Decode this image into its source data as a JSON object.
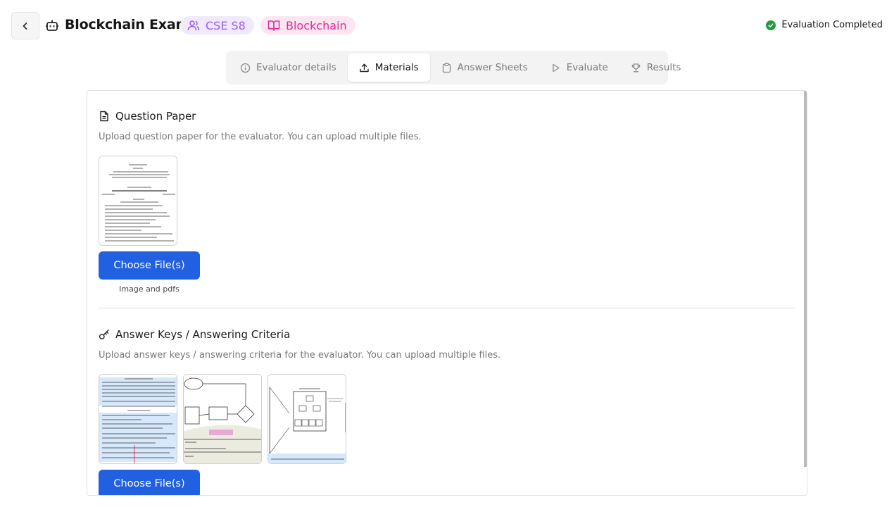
{
  "header": {
    "title": "Blockchain Exam",
    "class_badge": "CSE S8",
    "subject_badge": "Blockchain",
    "status": "Evaluation Completed",
    "colors": {
      "class_badge": "#9a5ee8",
      "subject_badge": "#e0299a",
      "status_ok": "#1f9c3e"
    }
  },
  "tabs": [
    {
      "label": "Evaluator details",
      "icon": "info-icon",
      "active": false
    },
    {
      "label": "Materials",
      "icon": "upload-icon",
      "active": true
    },
    {
      "label": "Answer Sheets",
      "icon": "clipboard-icon",
      "active": false
    },
    {
      "label": "Evaluate",
      "icon": "play-icon",
      "active": false
    },
    {
      "label": "Results",
      "icon": "trophy-icon",
      "active": false
    }
  ],
  "question_paper": {
    "title": "Question Paper",
    "description": "Upload question paper for the evaluator. You can upload multiple files.",
    "button": "Choose File(s)",
    "hint": "Image and pdfs"
  },
  "answer_keys": {
    "title": "Answer Keys / Answering Criteria",
    "description": "Upload answer keys / answering criteria for the evaluator. You can upload multiple files.",
    "button": "Choose File(s)"
  },
  "accent_color": "#2160e0"
}
